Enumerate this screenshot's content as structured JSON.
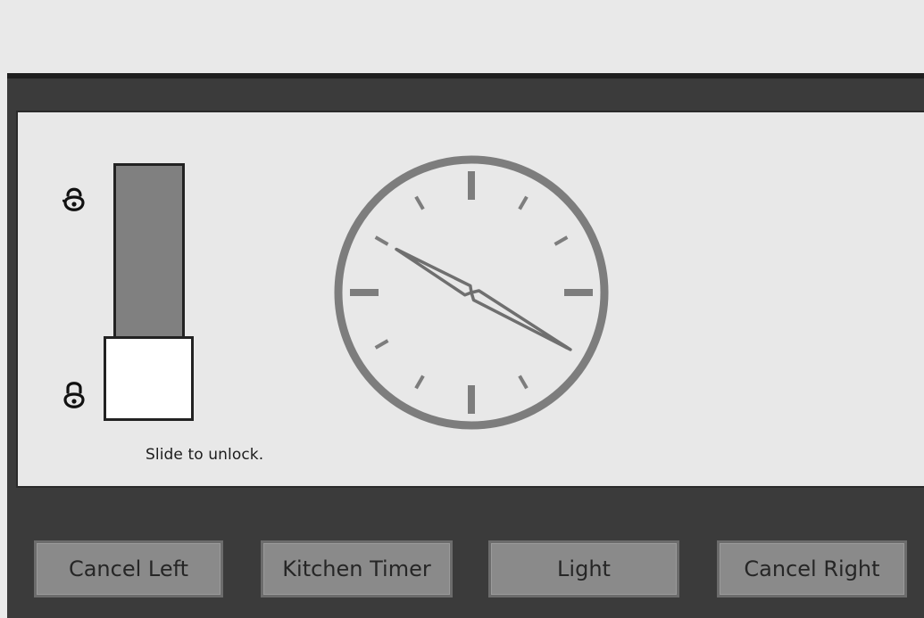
{
  "lock_screen": {
    "hint_text": "Slide to unlock.",
    "icons": {
      "top": "unlocked-lock-icon",
      "bottom": "locked-lock-icon"
    },
    "slider_level": 0
  },
  "clock": {
    "type": "analog",
    "hour_hand_angle_deg": 300,
    "minute_hand_angle_deg": 120,
    "face_color": "#e8e8e8",
    "stroke_color": "#7d7d7d"
  },
  "buttons": {
    "cancel_left": "Cancel Left",
    "kitchen_timer": "Kitchen Timer",
    "light": "Light",
    "cancel_right": "Cancel Right"
  },
  "colors": {
    "panel_dark": "#3b3b3b",
    "screen_bg": "#e8e8e8",
    "button_bg": "#8a8a8a",
    "slider_fill": "#808080"
  }
}
